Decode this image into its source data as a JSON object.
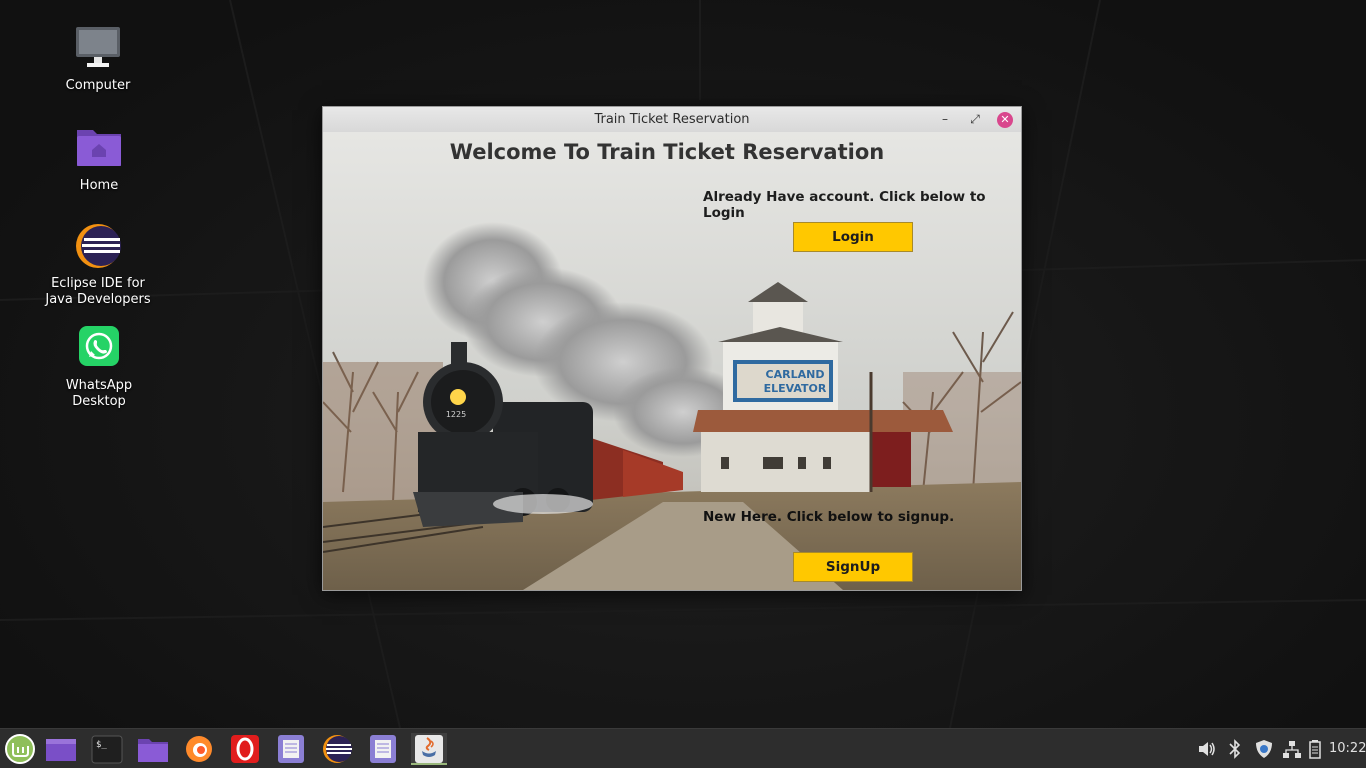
{
  "desktop": {
    "icons": [
      {
        "label": "Computer"
      },
      {
        "label": "Home"
      },
      {
        "label": "Eclipse IDE for Java Developers"
      },
      {
        "label": "WhatsApp Desktop"
      }
    ]
  },
  "window": {
    "title": "Train Ticket Reservation",
    "controls": {
      "minimize": "–",
      "maximize": "⤢",
      "close": "✕"
    },
    "heading": "Welcome To Train Ticket Reservation",
    "login_prompt": "Already Have account. Click below to Login",
    "login_button": "Login",
    "signup_prompt": "New Here. Click below to signup.",
    "signup_button": "SignUp",
    "background": {
      "sign_line1": "CARLAND",
      "sign_line2": "ELEVATOR",
      "engine_number": "1225"
    }
  },
  "taskbar": {
    "items": [
      {
        "icon": "mint-menu-icon"
      },
      {
        "icon": "show-desktop-icon"
      },
      {
        "icon": "terminal-icon",
        "glyph": "$_"
      },
      {
        "icon": "files-icon"
      },
      {
        "icon": "firefox-icon"
      },
      {
        "icon": "opera-icon",
        "glyph": "O"
      },
      {
        "icon": "text-editor-icon"
      },
      {
        "icon": "eclipse-icon"
      },
      {
        "icon": "text-editor-icon"
      },
      {
        "icon": "java-icon"
      }
    ],
    "tray": {
      "clock": "10:22",
      "icons": [
        "volume-icon",
        "bluetooth-icon",
        "update-shield-icon",
        "network-icon",
        "battery-icon"
      ]
    }
  },
  "colors": {
    "button": "#ffc800",
    "folder": "#8a5bd6",
    "close_button": "#d9478d",
    "whatsapp": "#25d366"
  }
}
